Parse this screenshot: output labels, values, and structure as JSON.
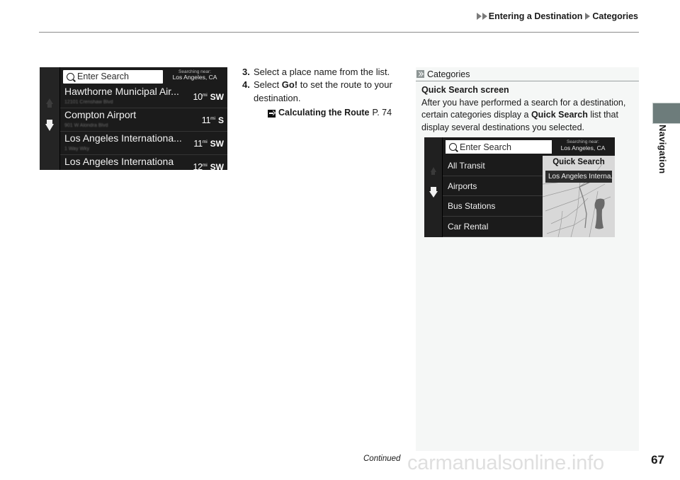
{
  "header": {
    "breadcrumb": {
      "section": "Entering a Destination",
      "subsection": "Categories"
    }
  },
  "side_tab": {
    "label": "Navigation",
    "color": "#6d7c7b"
  },
  "list_screenshot": {
    "search": {
      "placeholder": "Enter Search",
      "near_label": "Searching near:",
      "near_value": "Los Angeles, CA"
    },
    "results": [
      {
        "name": "Hawthorne Municipal Air...",
        "subtitle": "12101 Crenshaw Blvd",
        "distance": "10",
        "unit": "mi",
        "direction": "SW"
      },
      {
        "name": "Compton Airport",
        "subtitle": "901 W Alondra Blvd",
        "distance": "11",
        "unit": "mi",
        "direction": "S"
      },
      {
        "name": "Los Angeles Internationa...",
        "subtitle": "1 Way Wky",
        "distance": "11",
        "unit": "mi",
        "direction": "SW"
      },
      {
        "name": "Los Angeles Internationa",
        "subtitle": "",
        "distance": "12",
        "unit": "mi",
        "direction": "SW"
      }
    ]
  },
  "steps": [
    {
      "number": "3.",
      "parts": [
        {
          "text": "Select a place name from the list.",
          "bold": false
        }
      ]
    },
    {
      "number": "4.",
      "parts": [
        {
          "text": "Select ",
          "bold": false
        },
        {
          "text": "Go!",
          "bold": true
        },
        {
          "text": " to set the route to your destination.",
          "bold": false
        }
      ]
    }
  ],
  "cross_reference": {
    "title": "Calculating the Route",
    "page": "P. 74"
  },
  "note_panel": {
    "head_label": "Categories",
    "subtitle": "Quick Search screen",
    "body_parts": [
      {
        "text": "After you have performed a search for a destination, certain categories display a ",
        "bold": false
      },
      {
        "text": "Quick Search",
        "bold": true
      },
      {
        "text": " list that display several destinations you selected.",
        "bold": false
      }
    ]
  },
  "quick_screenshot": {
    "search": {
      "placeholder": "Enter Search",
      "near_label": "Searching near:",
      "near_value": "Los Angeles, CA"
    },
    "categories": [
      {
        "label": "All Transit"
      },
      {
        "label": "Airports"
      },
      {
        "label": "Bus Stations"
      },
      {
        "label": "Car Rental"
      }
    ],
    "map_pane": {
      "title": "Quick Search",
      "chip": "Los Angeles Interna..."
    }
  },
  "footer": {
    "continued": "Continued",
    "watermark": "carmanualsonline.info",
    "page_number": "67"
  }
}
